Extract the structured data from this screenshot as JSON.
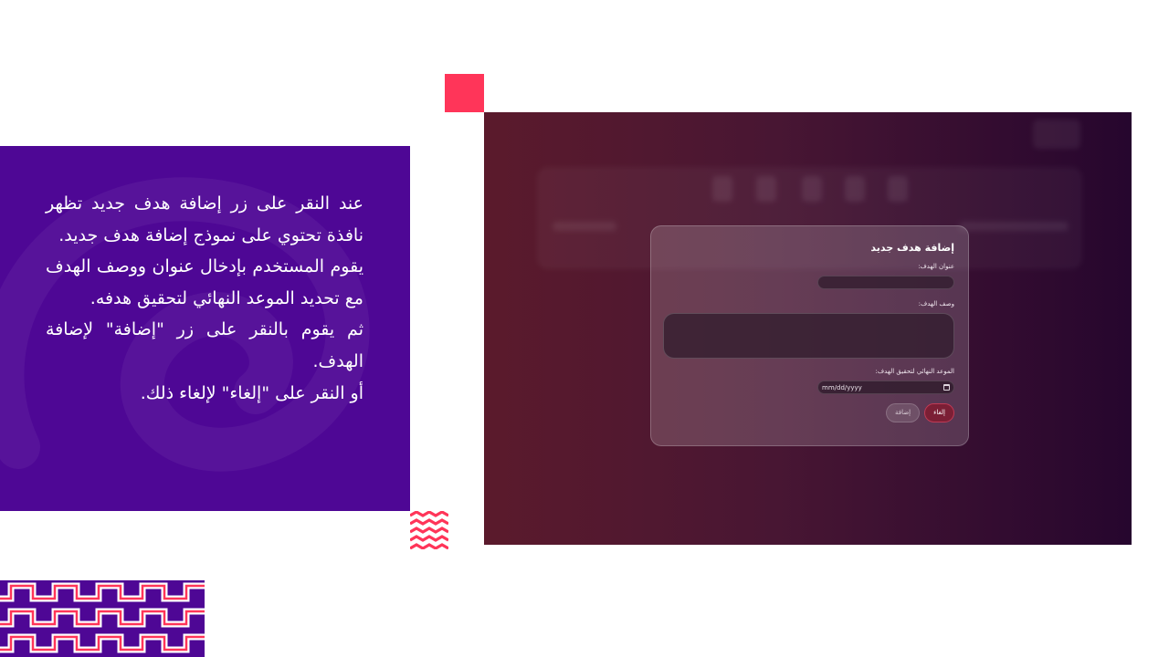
{
  "description": {
    "paragraphs": [
      "عند النقر على زر إضافة هدف جديد تظهر نافذة تحتوي على نموذج إضافة هدف جديد.",
      "يقوم المستخدم بإدخال عنوان ووصف الهدف مع تحديد الموعد النهائي لتحقيق هدفه.",
      "ثم يقوم بالنقر على زر \"إضافة\" لإضافة الهدف.",
      "أو النقر على \"إلغاء\" لإلغاء ذلك."
    ]
  },
  "modal": {
    "title": "إضافة هدف جديد",
    "title_label": "عنوان الهدف:",
    "description_label": "وصف الهدف:",
    "deadline_label": "الموعد النهائي لتحقيق الهدف:",
    "date_placeholder": "mm/dd/yyyy",
    "cancel_button": "إلغاء",
    "add_button": "إضافة"
  },
  "colors": {
    "panel_purple": "#4e0795",
    "accent_pink": "#ff3559",
    "cancel_red": "#7b1f35"
  }
}
